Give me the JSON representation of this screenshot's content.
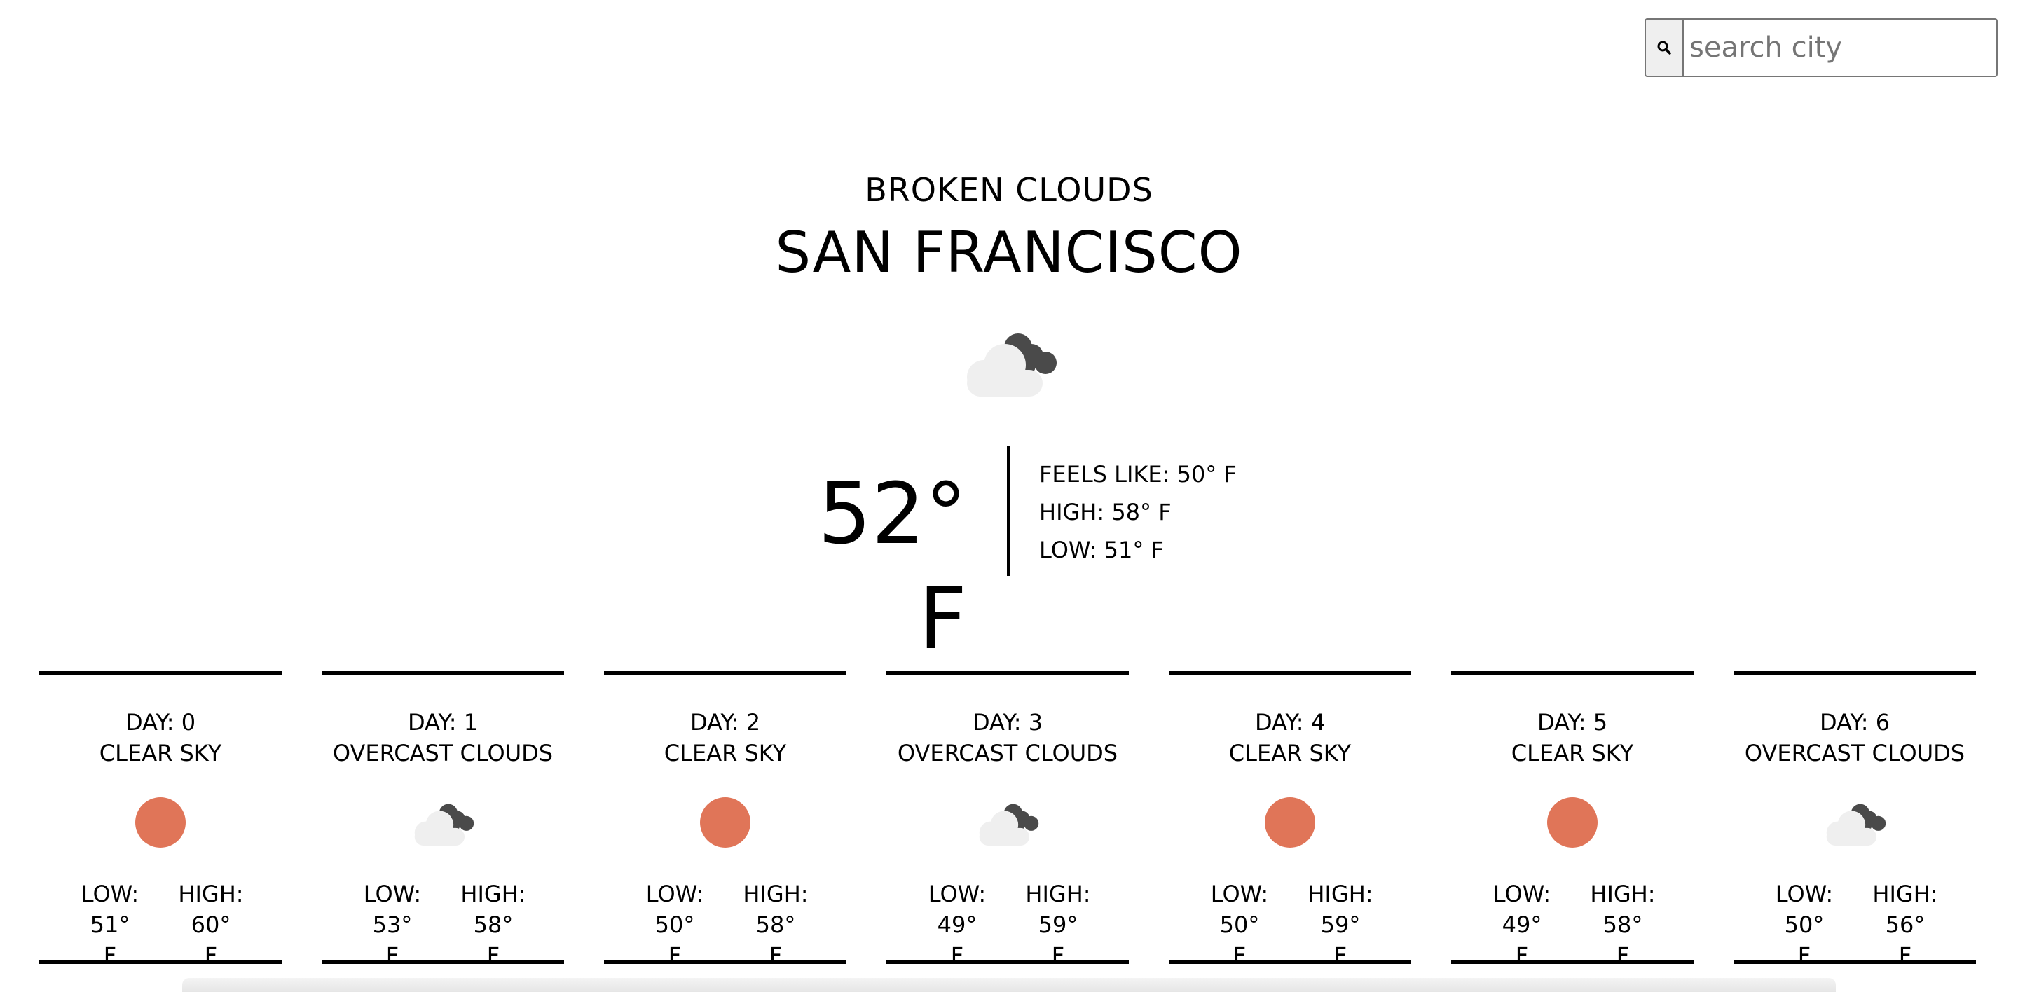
{
  "search": {
    "placeholder": "search city",
    "value": "",
    "icon": "search-icon"
  },
  "current": {
    "description": "BROKEN CLOUDS",
    "city": "SAN FRANCISCO",
    "icon": "broken-clouds-icon",
    "temp": "52° F",
    "feels_like": "FEELS LIKE: 50° F",
    "high": "HIGH: 58° F",
    "low": "LOW: 51° F"
  },
  "colors": {
    "sun": "#e07558",
    "cloud_light": "#efefef",
    "cloud_dark": "#4a4a4a"
  },
  "forecast": [
    {
      "day": "DAY: 0",
      "desc": "CLEAR SKY",
      "icon": "sun-icon",
      "low_a": "LOW: 51°",
      "low_b": "F",
      "high_a": "HIGH: 60°",
      "high_b": "F"
    },
    {
      "day": "DAY: 1",
      "desc": "OVERCAST CLOUDS",
      "icon": "cloud-icon",
      "low_a": "LOW: 53°",
      "low_b": "F",
      "high_a": "HIGH: 58°",
      "high_b": "F"
    },
    {
      "day": "DAY: 2",
      "desc": "CLEAR SKY",
      "icon": "sun-icon",
      "low_a": "LOW: 50°",
      "low_b": "F",
      "high_a": "HIGH: 58°",
      "high_b": "F"
    },
    {
      "day": "DAY: 3",
      "desc": "OVERCAST CLOUDS",
      "icon": "cloud-icon",
      "low_a": "LOW: 49°",
      "low_b": "F",
      "high_a": "HIGH: 59°",
      "high_b": "F"
    },
    {
      "day": "DAY: 4",
      "desc": "CLEAR SKY",
      "icon": "sun-icon",
      "low_a": "LOW: 50°",
      "low_b": "F",
      "high_a": "HIGH: 59°",
      "high_b": "F"
    },
    {
      "day": "DAY: 5",
      "desc": "CLEAR SKY",
      "icon": "sun-icon",
      "low_a": "LOW: 49°",
      "low_b": "F",
      "high_a": "HIGH: 58°",
      "high_b": "F"
    },
    {
      "day": "DAY: 6",
      "desc": "OVERCAST CLOUDS",
      "icon": "cloud-icon",
      "low_a": "LOW: 50°",
      "low_b": "F",
      "high_a": "HIGH: 56°",
      "high_b": "F"
    }
  ]
}
